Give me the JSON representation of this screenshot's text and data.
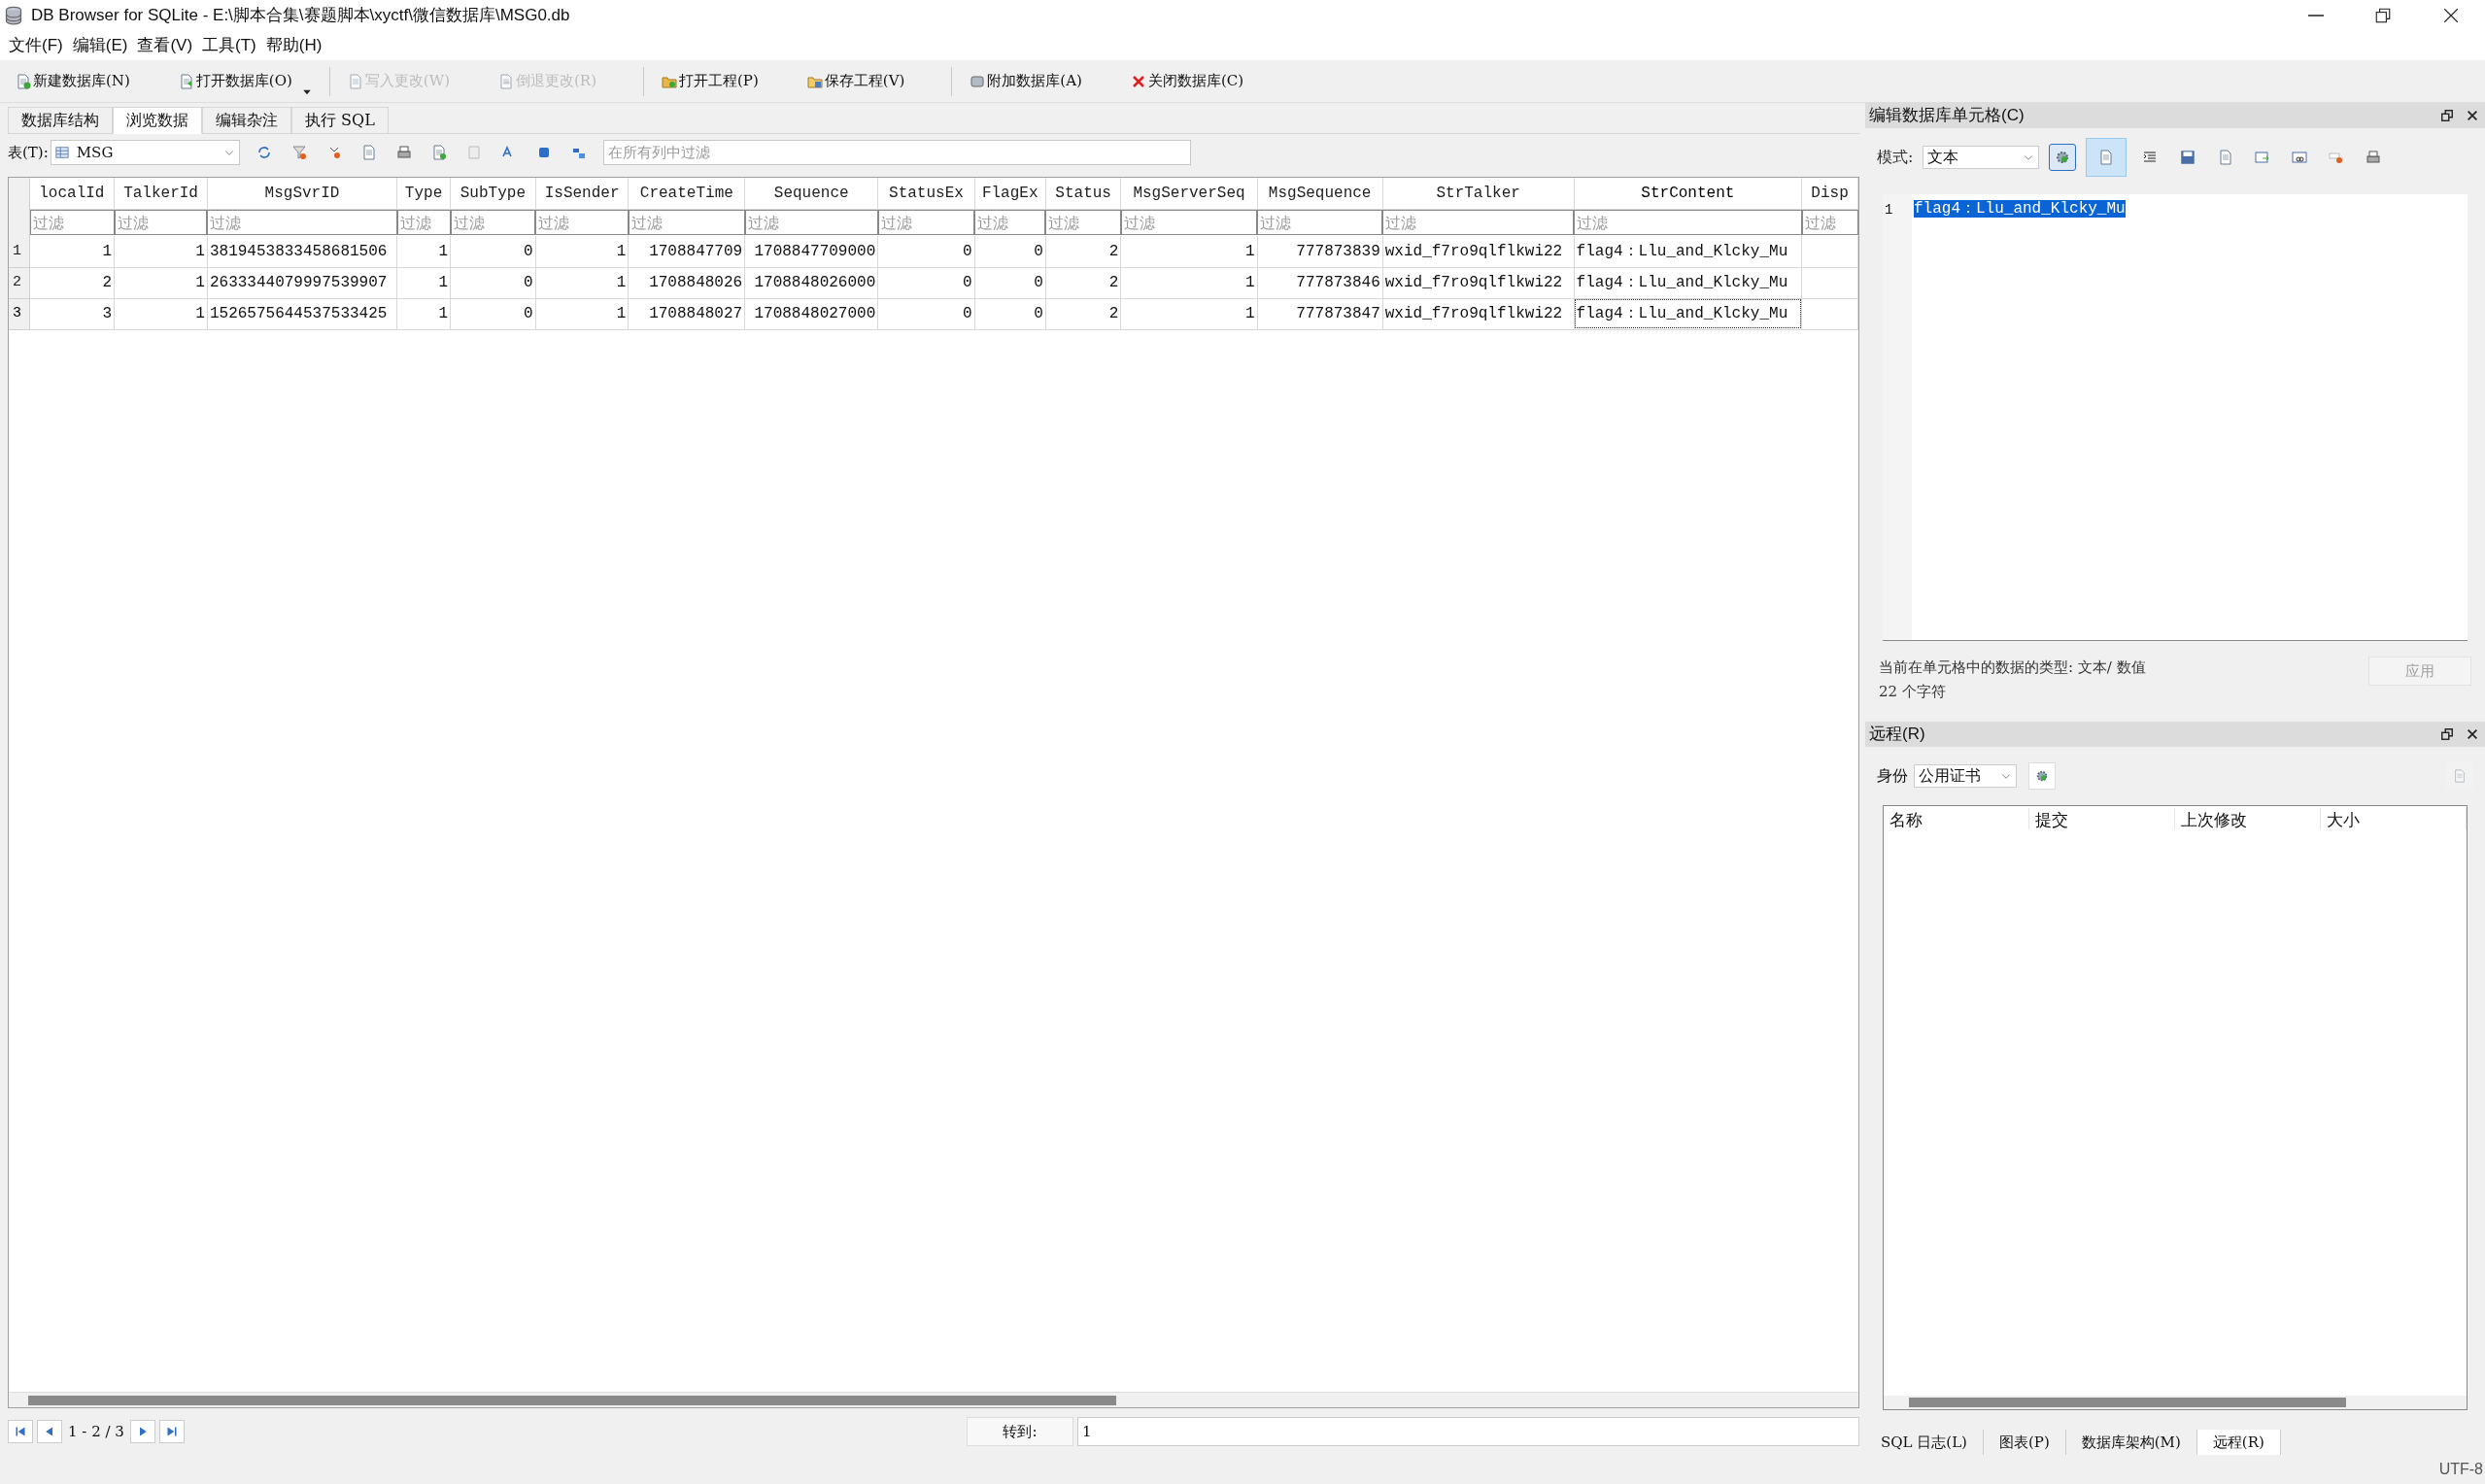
{
  "window": {
    "title": "DB Browser for SQLite - E:\\脚本合集\\赛题脚本\\xyctf\\微信数据库\\MSG0.db"
  },
  "menu": [
    "文件(F)",
    "编辑(E)",
    "查看(V)",
    "工具(T)",
    "帮助(H)"
  ],
  "toolbar_groups": [
    [
      {
        "label": "新建数据库(N)",
        "disabled": false,
        "has_menu": false
      },
      {
        "label": "打开数据库(O)",
        "disabled": false,
        "has_menu": true
      }
    ],
    [
      {
        "label": "写入更改(W)",
        "disabled": true,
        "has_menu": false
      },
      {
        "label": "倒退更改(R)",
        "disabled": true,
        "has_menu": false
      }
    ],
    [
      {
        "label": "打开工程(P)",
        "disabled": false,
        "has_menu": false
      },
      {
        "label": "保存工程(V)",
        "disabled": false,
        "has_menu": false
      }
    ],
    [
      {
        "label": "附加数据库(A)",
        "disabled": false,
        "has_menu": false
      },
      {
        "label": "关闭数据库(C)",
        "disabled": false,
        "has_menu": false
      }
    ]
  ],
  "tabs": [
    {
      "label": "数据库结构",
      "selected": false
    },
    {
      "label": "浏览数据",
      "selected": true
    },
    {
      "label": "编辑杂注",
      "selected": false
    },
    {
      "label": "执行 SQL",
      "selected": false
    }
  ],
  "table_bar": {
    "label": "表(T):",
    "table": "MSG",
    "filter_placeholder": "在所有列中过滤"
  },
  "table": {
    "columns": [
      {
        "name": "localId",
        "numeric": true,
        "placeholder": "过滤",
        "current": false
      },
      {
        "name": "TalkerId",
        "numeric": true,
        "placeholder": "过滤",
        "current": false
      },
      {
        "name": "MsgSvrID",
        "numeric": false,
        "placeholder": "过滤",
        "current": false
      },
      {
        "name": "Type",
        "numeric": true,
        "placeholder": "过滤",
        "current": false
      },
      {
        "name": "SubType",
        "numeric": true,
        "placeholder": "过滤",
        "current": false
      },
      {
        "name": "IsSender",
        "numeric": true,
        "placeholder": "过滤",
        "current": false
      },
      {
        "name": "CreateTime",
        "numeric": true,
        "placeholder": "过滤",
        "current": false
      },
      {
        "name": "Sequence",
        "numeric": true,
        "placeholder": "过滤",
        "current": false
      },
      {
        "name": "StatusEx",
        "numeric": true,
        "placeholder": "过滤",
        "current": false
      },
      {
        "name": "FlagEx",
        "numeric": true,
        "placeholder": "过滤",
        "current": false
      },
      {
        "name": "Status",
        "numeric": true,
        "placeholder": "过滤",
        "current": false
      },
      {
        "name": "MsgServerSeq",
        "numeric": true,
        "placeholder": "过滤",
        "current": false
      },
      {
        "name": "MsgSequence",
        "numeric": true,
        "placeholder": "过滤",
        "current": false
      },
      {
        "name": "StrTalker",
        "numeric": false,
        "placeholder": "过滤",
        "current": false
      },
      {
        "name": "StrContent",
        "numeric": false,
        "placeholder": "过滤",
        "current": true
      },
      {
        "name": "Disp",
        "numeric": false,
        "placeholder": "过滤",
        "current": false
      }
    ],
    "rows": [
      {
        "number": "1",
        "current": false,
        "cells": [
          "1",
          "1",
          "3819453833458681506",
          "1",
          "0",
          "1",
          "1708847709",
          "1708847709000",
          "0",
          "0",
          "2",
          "1",
          "777873839",
          "wxid_f7ro9qlflkwi22",
          "flag4：Llu_and_Klcky_Mu",
          ""
        ]
      },
      {
        "number": "2",
        "current": false,
        "cells": [
          "2",
          "1",
          "2633344079997539907",
          "1",
          "0",
          "1",
          "1708848026",
          "1708848026000",
          "0",
          "0",
          "2",
          "1",
          "777873846",
          "wxid_f7ro9qlflkwi22",
          "flag4：Llu_and_Klcky_Mu",
          ""
        ]
      },
      {
        "number": "3",
        "current": true,
        "cells": [
          "3",
          "1",
          "1526575644537533425",
          "1",
          "0",
          "1",
          "1708848027",
          "1708848027000",
          "0",
          "0",
          "2",
          "1",
          "777873847",
          "wxid_f7ro9qlflkwi22",
          "flag4：Llu_and_Klcky_Mu",
          ""
        ]
      }
    ]
  },
  "pager": {
    "range": "1 - 2 / 3",
    "goto_label": "转到:",
    "goto_value": "1"
  },
  "edit_cell": {
    "title": "编辑数据库单元格(C)",
    "mode_label": "模式:",
    "mode": "文本",
    "line_number": "1",
    "content": "flag4：Llu_and_Klcky_Mu",
    "content_selected": true,
    "type_info": "当前在单元格中的数据的类型: 文本/ 数值",
    "char_count": "22 个字符",
    "apply": {
      "label": "应用",
      "disabled": true
    }
  },
  "remote": {
    "title": "远程(R)",
    "identity_label": "身份",
    "identity": "公用证书",
    "columns": [
      "名称",
      "提交",
      "上次修改",
      "大小"
    ]
  },
  "dock_tabs": [
    {
      "label": "SQL 日志(L)",
      "selected": false
    },
    {
      "label": "图表(P)",
      "selected": false
    },
    {
      "label": "数据库架构(M)",
      "selected": false
    },
    {
      "label": "远程(R)",
      "selected": true
    }
  ],
  "status_bar": {
    "encoding": "UTF-8"
  }
}
